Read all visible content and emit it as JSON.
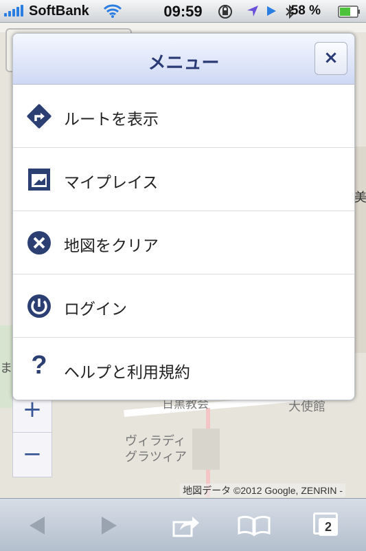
{
  "status_bar": {
    "carrier": "SoftBank",
    "time": "09:59",
    "battery_percent": "58 %",
    "icons": [
      "signal-icon",
      "wifi-icon",
      "rotation-lock-icon",
      "location-icon",
      "play-icon",
      "bluetooth-icon",
      "battery-icon"
    ]
  },
  "menu": {
    "title": "メニュー",
    "close_label": "×",
    "items": [
      {
        "label": "ルートを表示",
        "icon": "route-icon"
      },
      {
        "label": "マイプレイス",
        "icon": "my-places-icon"
      },
      {
        "label": "地図をクリア",
        "icon": "clear-map-icon"
      },
      {
        "label": "ログイン",
        "icon": "power-icon"
      },
      {
        "label": "ヘルプと利用規約",
        "icon": "help-icon"
      }
    ]
  },
  "map": {
    "zoom_in": "+",
    "zoom_out": "−",
    "labels": [
      "日黒教会",
      "大使館",
      "ヴィラディ",
      "グラツィア",
      "美",
      "ま"
    ],
    "attribution": "地図データ ©2012 Google, ZENRIN -"
  },
  "toolbar": {
    "back_icon": "back-arrow-icon",
    "forward_icon": "forward-arrow-icon",
    "share_icon": "share-icon",
    "bookmarks_icon": "bookmarks-icon",
    "tabs_count": "2"
  },
  "colors": {
    "accent": "#2a3a74",
    "icon_blue": "#2b3f73",
    "header_gradient_bottom": "#cfd9f4"
  }
}
